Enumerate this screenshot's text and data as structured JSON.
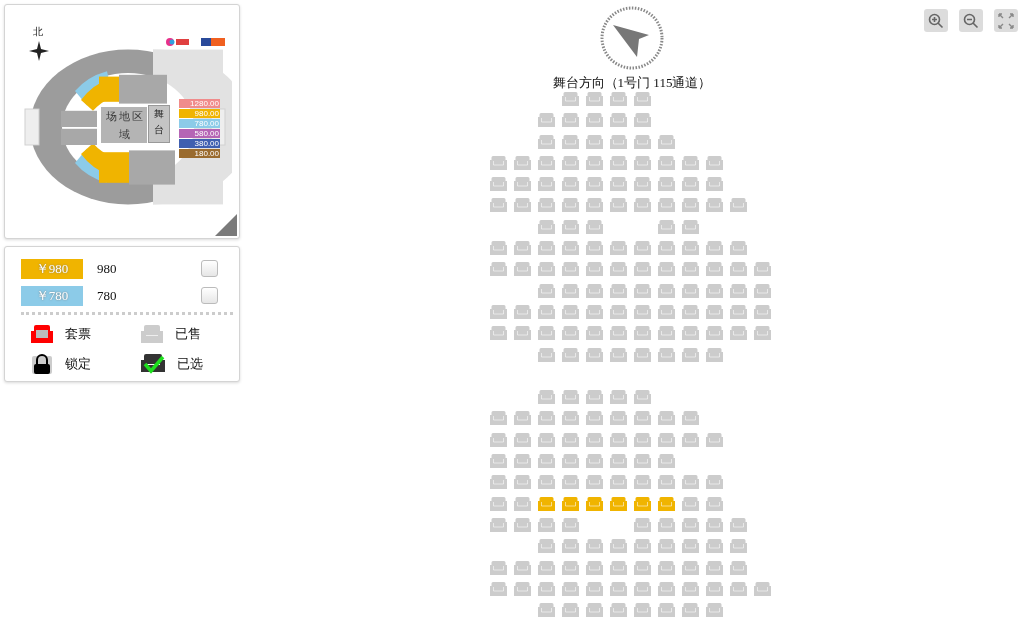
{
  "overview_map": {
    "north_label": "北",
    "field_label": "场地区域",
    "stage_label": "舞台",
    "prices": [
      {
        "label": "1280.00",
        "color": "#f08c8c"
      },
      {
        "label": "980.00",
        "color": "#f0b400"
      },
      {
        "label": "780.00",
        "color": "#8ccbe8"
      },
      {
        "label": "580.00",
        "color": "#b565b5"
      },
      {
        "label": "380.00",
        "color": "#3f5fb0"
      },
      {
        "label": "180.00",
        "color": "#9a6b2e"
      }
    ]
  },
  "price_filters": [
    {
      "tag": "￥980",
      "label": "980",
      "color": "#f0b400",
      "checked": false
    },
    {
      "tag": "￥780",
      "label": "780",
      "color": "#8ccbe8",
      "checked": false
    }
  ],
  "legend": [
    {
      "kind": "package",
      "label": "套票"
    },
    {
      "kind": "sold",
      "label": "已售"
    },
    {
      "kind": "locked",
      "label": "锁定"
    },
    {
      "kind": "selected",
      "label": "已选"
    }
  ],
  "stage_direction": "舞台方向（1号门 115通道）",
  "seat_rows": [
    {
      "seats": [
        {
          "kind": "aisle"
        },
        {
          "kind": "aisle"
        },
        {
          "kind": "aisle"
        },
        {
          "kind": "sold"
        },
        {
          "kind": "sold"
        },
        {
          "kind": "sold"
        },
        {
          "kind": "sold"
        }
      ]
    },
    {
      "seats": [
        {
          "kind": "aisle"
        },
        {
          "kind": "aisle"
        },
        {
          "kind": "sold"
        },
        {
          "kind": "sold"
        },
        {
          "kind": "sold"
        },
        {
          "kind": "sold"
        },
        {
          "kind": "sold"
        }
      ]
    },
    {
      "seats": [
        {
          "kind": "aisle"
        },
        {
          "kind": "aisle"
        },
        {
          "kind": "sold"
        },
        {
          "kind": "sold"
        },
        {
          "kind": "sold"
        },
        {
          "kind": "sold"
        },
        {
          "kind": "sold"
        },
        {
          "kind": "sold"
        }
      ]
    },
    {
      "seats": [
        {
          "kind": "sold"
        },
        {
          "kind": "sold"
        },
        {
          "kind": "sold"
        },
        {
          "kind": "sold"
        },
        {
          "kind": "sold"
        },
        {
          "kind": "sold"
        },
        {
          "kind": "sold"
        },
        {
          "kind": "sold"
        },
        {
          "kind": "sold"
        },
        {
          "kind": "sold"
        }
      ]
    },
    {
      "seats": [
        {
          "kind": "sold"
        },
        {
          "kind": "sold"
        },
        {
          "kind": "sold"
        },
        {
          "kind": "sold"
        },
        {
          "kind": "sold"
        },
        {
          "kind": "sold"
        },
        {
          "kind": "sold"
        },
        {
          "kind": "sold"
        },
        {
          "kind": "sold"
        },
        {
          "kind": "sold"
        }
      ]
    },
    {
      "seats": [
        {
          "kind": "sold"
        },
        {
          "kind": "sold"
        },
        {
          "kind": "sold"
        },
        {
          "kind": "sold"
        },
        {
          "kind": "sold"
        },
        {
          "kind": "sold"
        },
        {
          "kind": "sold"
        },
        {
          "kind": "sold"
        },
        {
          "kind": "sold"
        },
        {
          "kind": "sold"
        },
        {
          "kind": "sold"
        }
      ]
    },
    {
      "seats": [
        {
          "kind": "aisle"
        },
        {
          "kind": "aisle"
        },
        {
          "kind": "sold"
        },
        {
          "kind": "sold"
        },
        {
          "kind": "sold"
        },
        {
          "kind": "aisle"
        },
        {
          "kind": "aisle"
        },
        {
          "kind": "sold"
        },
        {
          "kind": "sold"
        }
      ]
    },
    {
      "seats": [
        {
          "kind": "sold"
        },
        {
          "kind": "sold"
        },
        {
          "kind": "sold"
        },
        {
          "kind": "sold"
        },
        {
          "kind": "sold"
        },
        {
          "kind": "sold"
        },
        {
          "kind": "sold"
        },
        {
          "kind": "sold"
        },
        {
          "kind": "sold"
        },
        {
          "kind": "sold"
        },
        {
          "kind": "sold"
        }
      ]
    },
    {
      "seats": [
        {
          "kind": "sold"
        },
        {
          "kind": "sold"
        },
        {
          "kind": "sold"
        },
        {
          "kind": "sold"
        },
        {
          "kind": "sold"
        },
        {
          "kind": "sold"
        },
        {
          "kind": "sold"
        },
        {
          "kind": "sold"
        },
        {
          "kind": "sold"
        },
        {
          "kind": "sold"
        },
        {
          "kind": "sold"
        },
        {
          "kind": "sold"
        }
      ]
    },
    {
      "seats": [
        {
          "kind": "aisle"
        },
        {
          "kind": "aisle"
        },
        {
          "kind": "sold"
        },
        {
          "kind": "sold"
        },
        {
          "kind": "sold"
        },
        {
          "kind": "sold"
        },
        {
          "kind": "sold"
        },
        {
          "kind": "sold"
        },
        {
          "kind": "sold"
        },
        {
          "kind": "sold"
        },
        {
          "kind": "sold"
        },
        {
          "kind": "sold"
        }
      ]
    },
    {
      "seats": [
        {
          "kind": "sold"
        },
        {
          "kind": "sold"
        },
        {
          "kind": "sold"
        },
        {
          "kind": "sold"
        },
        {
          "kind": "sold"
        },
        {
          "kind": "sold"
        },
        {
          "kind": "sold"
        },
        {
          "kind": "sold"
        },
        {
          "kind": "sold"
        },
        {
          "kind": "sold"
        },
        {
          "kind": "sold"
        },
        {
          "kind": "sold"
        }
      ]
    },
    {
      "seats": [
        {
          "kind": "sold"
        },
        {
          "kind": "sold"
        },
        {
          "kind": "sold"
        },
        {
          "kind": "sold"
        },
        {
          "kind": "sold"
        },
        {
          "kind": "sold"
        },
        {
          "kind": "sold"
        },
        {
          "kind": "sold"
        },
        {
          "kind": "sold"
        },
        {
          "kind": "sold"
        },
        {
          "kind": "sold"
        },
        {
          "kind": "sold"
        }
      ]
    },
    {
      "seats": [
        {
          "kind": "aisle"
        },
        {
          "kind": "aisle"
        },
        {
          "kind": "sold"
        },
        {
          "kind": "sold"
        },
        {
          "kind": "sold"
        },
        {
          "kind": "sold"
        },
        {
          "kind": "sold"
        },
        {
          "kind": "sold"
        },
        {
          "kind": "sold"
        },
        {
          "kind": "sold"
        }
      ]
    },
    {
      "seats": [
        {
          "kind": "aisle"
        }
      ]
    },
    {
      "seats": [
        {
          "kind": "aisle"
        },
        {
          "kind": "aisle"
        },
        {
          "kind": "sold"
        },
        {
          "kind": "sold"
        },
        {
          "kind": "sold"
        },
        {
          "kind": "sold"
        },
        {
          "kind": "sold"
        }
      ]
    },
    {
      "seats": [
        {
          "kind": "sold"
        },
        {
          "kind": "sold"
        },
        {
          "kind": "sold"
        },
        {
          "kind": "sold"
        },
        {
          "kind": "sold"
        },
        {
          "kind": "sold"
        },
        {
          "kind": "sold"
        },
        {
          "kind": "sold"
        },
        {
          "kind": "sold"
        }
      ]
    },
    {
      "seats": [
        {
          "kind": "sold"
        },
        {
          "kind": "sold"
        },
        {
          "kind": "sold"
        },
        {
          "kind": "sold"
        },
        {
          "kind": "sold"
        },
        {
          "kind": "sold"
        },
        {
          "kind": "sold"
        },
        {
          "kind": "sold"
        },
        {
          "kind": "sold"
        },
        {
          "kind": "sold"
        }
      ]
    },
    {
      "seats": [
        {
          "kind": "sold"
        },
        {
          "kind": "sold"
        },
        {
          "kind": "sold"
        },
        {
          "kind": "sold"
        },
        {
          "kind": "sold"
        },
        {
          "kind": "sold"
        },
        {
          "kind": "sold"
        },
        {
          "kind": "sold"
        }
      ]
    },
    {
      "seats": [
        {
          "kind": "sold"
        },
        {
          "kind": "sold"
        },
        {
          "kind": "sold"
        },
        {
          "kind": "sold"
        },
        {
          "kind": "sold"
        },
        {
          "kind": "sold"
        },
        {
          "kind": "sold"
        },
        {
          "kind": "sold"
        },
        {
          "kind": "sold"
        },
        {
          "kind": "sold"
        }
      ]
    },
    {
      "seats": [
        {
          "kind": "sold"
        },
        {
          "kind": "sold"
        },
        {
          "kind": "available"
        },
        {
          "kind": "available"
        },
        {
          "kind": "available"
        },
        {
          "kind": "available"
        },
        {
          "kind": "available"
        },
        {
          "kind": "available"
        },
        {
          "kind": "sold"
        },
        {
          "kind": "sold"
        }
      ]
    },
    {
      "seats": [
        {
          "kind": "sold"
        },
        {
          "kind": "sold"
        },
        {
          "kind": "sold"
        },
        {
          "kind": "sold"
        },
        {
          "kind": "aisle"
        },
        {
          "kind": "aisle"
        },
        {
          "kind": "sold"
        },
        {
          "kind": "sold"
        },
        {
          "kind": "sold"
        },
        {
          "kind": "sold"
        },
        {
          "kind": "sold"
        }
      ]
    },
    {
      "seats": [
        {
          "kind": "aisle"
        },
        {
          "kind": "aisle"
        },
        {
          "kind": "sold"
        },
        {
          "kind": "sold"
        },
        {
          "kind": "sold"
        },
        {
          "kind": "sold"
        },
        {
          "kind": "sold"
        },
        {
          "kind": "sold"
        },
        {
          "kind": "sold"
        },
        {
          "kind": "sold"
        },
        {
          "kind": "sold"
        }
      ]
    },
    {
      "seats": [
        {
          "kind": "sold"
        },
        {
          "kind": "sold"
        },
        {
          "kind": "sold"
        },
        {
          "kind": "sold"
        },
        {
          "kind": "sold"
        },
        {
          "kind": "sold"
        },
        {
          "kind": "sold"
        },
        {
          "kind": "sold"
        },
        {
          "kind": "sold"
        },
        {
          "kind": "sold"
        },
        {
          "kind": "sold"
        }
      ]
    },
    {
      "seats": [
        {
          "kind": "sold"
        },
        {
          "kind": "sold"
        },
        {
          "kind": "sold"
        },
        {
          "kind": "sold"
        },
        {
          "kind": "sold"
        },
        {
          "kind": "sold"
        },
        {
          "kind": "sold"
        },
        {
          "kind": "sold"
        },
        {
          "kind": "sold"
        },
        {
          "kind": "sold"
        },
        {
          "kind": "sold"
        },
        {
          "kind": "sold"
        }
      ]
    },
    {
      "seats": [
        {
          "kind": "aisle"
        },
        {
          "kind": "aisle"
        },
        {
          "kind": "sold"
        },
        {
          "kind": "sold"
        },
        {
          "kind": "sold"
        },
        {
          "kind": "sold"
        },
        {
          "kind": "sold"
        },
        {
          "kind": "sold"
        },
        {
          "kind": "sold"
        },
        {
          "kind": "sold"
        }
      ]
    }
  ]
}
